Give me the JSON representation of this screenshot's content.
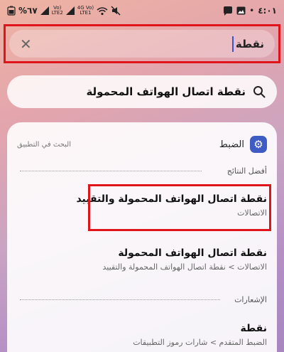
{
  "status_bar": {
    "time": "٤:٠١",
    "battery": "%٦٧",
    "carrier1_top": "Vo)",
    "carrier1_bottom": "LTE2",
    "net2_top": "4G",
    "net2_mid": "Vo)",
    "net2_bottom": "LTE1",
    "icons": [
      "chat-bubble-icon",
      "image-icon",
      "dot-icon",
      "wifi-icon",
      "mute-icon",
      "signal-icon",
      "battery-icon"
    ]
  },
  "search": {
    "value": "نقطة"
  },
  "suggestion": {
    "label": "نقطة اتصال الهواتف المحمولة"
  },
  "panel": {
    "app_name": "الضبط",
    "search_in_app": "البحث في التطبيق",
    "best_results_label": "أفضل النتائج",
    "notifications_label": "الإشعارات"
  },
  "results": [
    {
      "title": "نقطة اتصال الهواتف المحمولة والتقييد",
      "subtitle": "الاتصالات"
    },
    {
      "title": "نقطة اتصال الهواتف المحمولة",
      "subtitle": "الاتصالات > نقطة اتصال الهواتف المحمولة والتقييد"
    },
    {
      "title": "نقطة",
      "subtitle": "الضبط المتقدم > شارات رموز التطبيقات"
    }
  ],
  "colors": {
    "highlight": "#e0151b",
    "caret": "#3b53d6",
    "gear_bg": "#3f5bc4"
  }
}
